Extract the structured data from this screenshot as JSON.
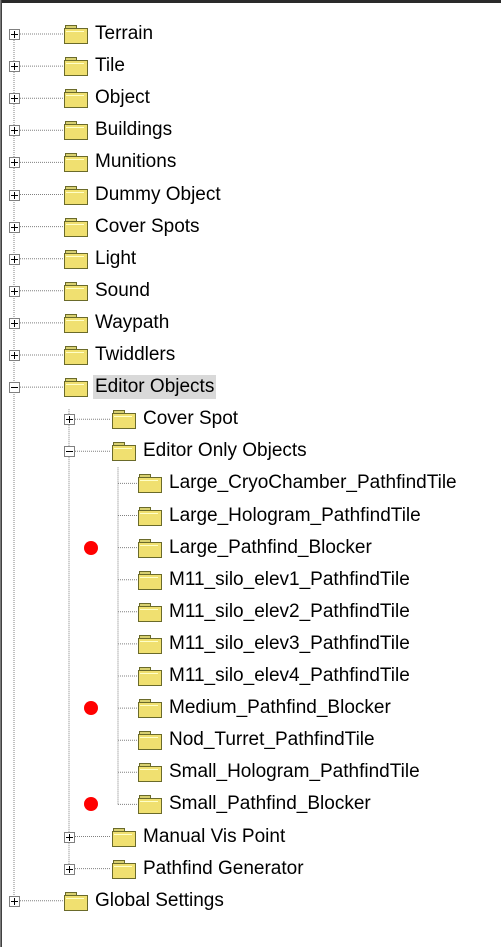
{
  "tree": {
    "nodes": [
      {
        "id": "terrain",
        "label": "Terrain",
        "level": 0,
        "state": "collapsed"
      },
      {
        "id": "tile",
        "label": "Tile",
        "level": 0,
        "state": "collapsed"
      },
      {
        "id": "object",
        "label": "Object",
        "level": 0,
        "state": "collapsed"
      },
      {
        "id": "buildings",
        "label": "Buildings",
        "level": 0,
        "state": "collapsed"
      },
      {
        "id": "munitions",
        "label": "Munitions",
        "level": 0,
        "state": "collapsed"
      },
      {
        "id": "dummy-object",
        "label": "Dummy Object",
        "level": 0,
        "state": "collapsed"
      },
      {
        "id": "cover-spots",
        "label": "Cover Spots",
        "level": 0,
        "state": "collapsed"
      },
      {
        "id": "light",
        "label": "Light",
        "level": 0,
        "state": "collapsed"
      },
      {
        "id": "sound",
        "label": "Sound",
        "level": 0,
        "state": "collapsed"
      },
      {
        "id": "waypath",
        "label": "Waypath",
        "level": 0,
        "state": "collapsed"
      },
      {
        "id": "twiddlers",
        "label": "Twiddlers",
        "level": 0,
        "state": "collapsed"
      },
      {
        "id": "editor-objects",
        "label": "Editor Objects",
        "level": 0,
        "state": "expanded",
        "selected": true
      },
      {
        "id": "cover-spot",
        "label": "Cover Spot",
        "level": 1,
        "state": "collapsed"
      },
      {
        "id": "editor-only-objects",
        "label": "Editor Only Objects",
        "level": 1,
        "state": "expanded"
      },
      {
        "id": "large-cryochamber",
        "label": "Large_CryoChamber_PathfindTile",
        "level": 2,
        "state": "leaf"
      },
      {
        "id": "large-hologram",
        "label": "Large_Hologram_PathfindTile",
        "level": 2,
        "state": "leaf"
      },
      {
        "id": "large-pathfind-blocker",
        "label": "Large_Pathfind_Blocker",
        "level": 2,
        "state": "leaf",
        "marked": true
      },
      {
        "id": "m11-silo-elev1",
        "label": "M11_silo_elev1_PathfindTile",
        "level": 2,
        "state": "leaf"
      },
      {
        "id": "m11-silo-elev2",
        "label": "M11_silo_elev2_PathfindTile",
        "level": 2,
        "state": "leaf"
      },
      {
        "id": "m11-silo-elev3",
        "label": "M11_silo_elev3_PathfindTile",
        "level": 2,
        "state": "leaf"
      },
      {
        "id": "m11-silo-elev4",
        "label": "M11_silo_elev4_PathfindTile",
        "level": 2,
        "state": "leaf"
      },
      {
        "id": "medium-pathfind-blocker",
        "label": "Medium_Pathfind_Blocker",
        "level": 2,
        "state": "leaf",
        "marked": true
      },
      {
        "id": "nod-turret",
        "label": "Nod_Turret_PathfindTile",
        "level": 2,
        "state": "leaf"
      },
      {
        "id": "small-hologram",
        "label": "Small_Hologram_PathfindTile",
        "level": 2,
        "state": "leaf"
      },
      {
        "id": "small-pathfind-blocker",
        "label": "Small_Pathfind_Blocker",
        "level": 2,
        "state": "leaf",
        "marked": true
      },
      {
        "id": "manual-vis-point",
        "label": "Manual Vis Point",
        "level": 1,
        "state": "collapsed"
      },
      {
        "id": "pathfind-generator",
        "label": "Pathfind Generator",
        "level": 1,
        "state": "collapsed"
      },
      {
        "id": "global-settings",
        "label": "Global Settings",
        "level": 0,
        "state": "collapsed"
      }
    ]
  },
  "colors": {
    "folder": "#f0e070",
    "marker": "#ff0000",
    "selection": "#d9d9d9",
    "tree_lines": "#808080"
  },
  "icons": {
    "folder": "folder-icon",
    "expand": "plus-box-icon",
    "collapse": "minus-box-icon",
    "marker": "red-dot-marker"
  }
}
